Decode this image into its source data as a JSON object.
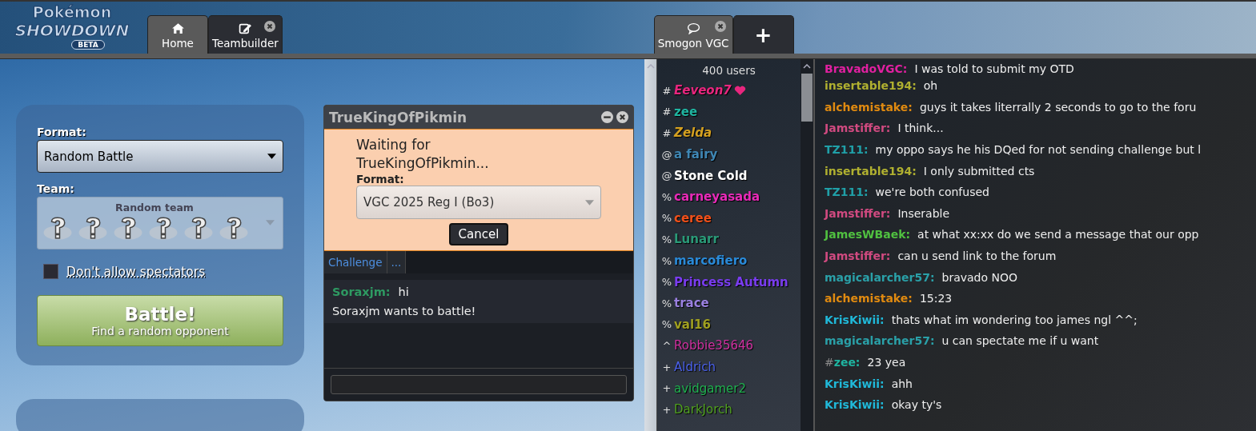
{
  "header": {
    "logo": {
      "line1": "Pokémon",
      "line2": "SHOWDOWN",
      "badge": "BETA"
    },
    "tabs": [
      {
        "label": "Home",
        "selected": true,
        "closable": false
      },
      {
        "label": "Teambuilder",
        "selected": false,
        "closable": true
      }
    ],
    "right_tabs": [
      {
        "label": "Smogon VGC",
        "selected": true,
        "closable": true,
        "kind": "room"
      },
      {
        "label": "+",
        "selected": false,
        "kind": "new"
      }
    ]
  },
  "battle_panel": {
    "format_label": "Format:",
    "format_value": "Random Battle",
    "team_label": "Team:",
    "team_value": "Random team",
    "spectators": {
      "label": "Don't allow spectators",
      "checked": false
    },
    "battle_button": {
      "title": "Battle!",
      "subtitle": "Find a random opponent"
    }
  },
  "challenge_window": {
    "title": "TrueKingOfPikmin",
    "waiting": "Waiting for TrueKingOfPikmin...",
    "format_label": "Format:",
    "format_value": "VGC 2025 Reg I (Bo3)",
    "cancel": "Cancel",
    "tabs": [
      {
        "label": "Challenge",
        "selected": false
      },
      {
        "label": "...",
        "selected": false
      }
    ],
    "messages": [
      {
        "kind": "chat",
        "user": "Soraxjm:",
        "text": "hi",
        "color": "#2e9a62"
      },
      {
        "kind": "notice",
        "text": "Soraxjm wants to battle!"
      }
    ]
  },
  "userlist": {
    "count": "400 users",
    "users": [
      {
        "rank": "#",
        "name": "Eeveon7",
        "color": "#e8267e",
        "bold": true,
        "italic": true,
        "heart": true
      },
      {
        "rank": "#",
        "name": "zee",
        "color": "#1fb4a0",
        "bold": true,
        "italic": false,
        "heart": false
      },
      {
        "rank": "#",
        "name": "Zelda",
        "color": "#d4a020",
        "bold": true,
        "italic": true,
        "heart": false
      },
      {
        "rank": "@",
        "name": "a fairy",
        "color": "#3f87b5",
        "bold": true,
        "italic": false,
        "heart": false
      },
      {
        "rank": "@",
        "name": "Stone Cold",
        "color": "#ffffff",
        "bold": true,
        "italic": false,
        "heart": false
      },
      {
        "rank": "%",
        "name": "carneyasada",
        "color": "#e82ab8",
        "bold": true,
        "italic": false,
        "heart": false
      },
      {
        "rank": "%",
        "name": "ceree",
        "color": "#f0501a",
        "bold": true,
        "italic": false,
        "heart": false
      },
      {
        "rank": "%",
        "name": "Lunarr",
        "color": "#2a9a78",
        "bold": true,
        "italic": false,
        "heart": false
      },
      {
        "rank": "%",
        "name": "marcofiero",
        "color": "#2a8ad8",
        "bold": true,
        "italic": false,
        "heart": false
      },
      {
        "rank": "%",
        "name": "Princess Autumn",
        "color": "#7a3cf0",
        "bold": true,
        "italic": false,
        "heart": false
      },
      {
        "rank": "%",
        "name": "trace",
        "color": "#9a80e0",
        "bold": true,
        "italic": false,
        "heart": false
      },
      {
        "rank": "%",
        "name": "val16",
        "color": "#a0a020",
        "bold": true,
        "italic": false,
        "heart": false
      },
      {
        "rank": "^",
        "name": "Robbie35646",
        "color": "#d030a0",
        "bold": false,
        "italic": false,
        "heart": false
      },
      {
        "rank": "+",
        "name": "Aldrich",
        "color": "#4a60e8",
        "bold": false,
        "italic": false,
        "heart": false
      },
      {
        "rank": "+",
        "name": "avidgamer2",
        "color": "#20b050",
        "bold": false,
        "italic": false,
        "heart": false
      },
      {
        "rank": "+",
        "name": "DarkJorch",
        "color": "#50a020",
        "bold": false,
        "italic": false,
        "heart": false
      }
    ]
  },
  "chat": [
    {
      "user": "BravadoVGC:",
      "text": "I was told to submit my OTD",
      "color": "#e020a0"
    },
    {
      "user": "insertable194:",
      "text": "oh",
      "color": "#b0b030"
    },
    {
      "user": "alchemistake:",
      "text": "guys it takes literrally 2 seconds to go to the foru",
      "color": "#e08a10"
    },
    {
      "user": "Jamstiffer:",
      "text": "I think...",
      "color": "#d04a80"
    },
    {
      "user": "TZ111:",
      "text": "my oppo says he his DQed for not sending challenge but l",
      "color": "#20a0a8"
    },
    {
      "user": "insertable194:",
      "text": "I only submitted cts",
      "color": "#b0b030"
    },
    {
      "user": "TZ111:",
      "text": "we're both confused",
      "color": "#20a0a8"
    },
    {
      "user": "Jamstiffer:",
      "text": "Inserable",
      "color": "#d04a80"
    },
    {
      "user": "JamesWBaek:",
      "text": "at what xx:xx do we send a message that our opp",
      "color": "#50c040"
    },
    {
      "user": "Jamstiffer:",
      "text": "can u send link to the forum",
      "color": "#d04a80"
    },
    {
      "user": "magicalarcher57:",
      "text": "bravado NOO",
      "color": "#2aa0a8"
    },
    {
      "user": "alchemistake:",
      "text": "15:23",
      "color": "#e08a10"
    },
    {
      "user": "KrisKiwii:",
      "text": "thats what im wondering too james ngl ^^;",
      "color": "#20b8d8"
    },
    {
      "user": "magicalarcher57:",
      "text": "u can spectate me if u want",
      "color": "#2aa0a8"
    },
    {
      "rank": "#",
      "user": "zee:",
      "text": "23 yea",
      "color": "#1fb4a0"
    },
    {
      "user": "KrisKiwii:",
      "text": "ahh",
      "color": "#20b8d8"
    },
    {
      "user": "KrisKiwii:",
      "text": "okay ty's",
      "color": "#20b8d8"
    }
  ]
}
